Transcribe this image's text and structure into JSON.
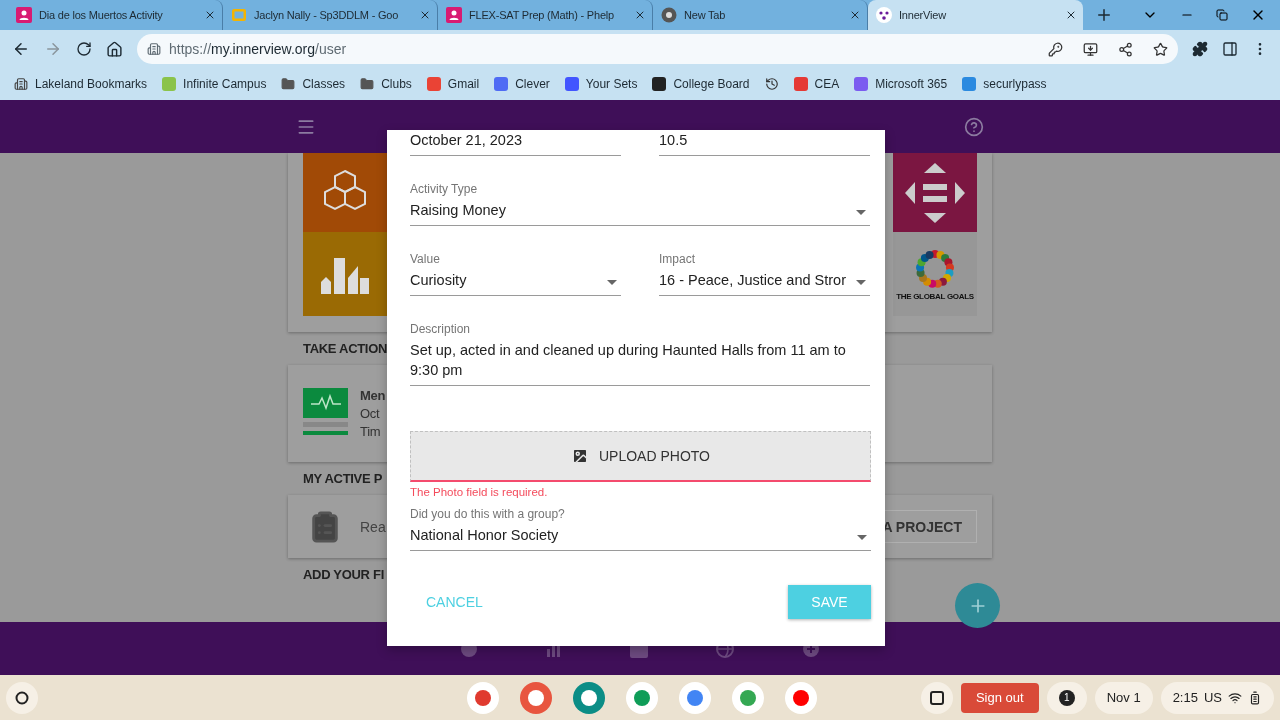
{
  "browser": {
    "tabs": [
      {
        "title": "Dia de los Muertos Activity",
        "selected": false,
        "kind": "classroom"
      },
      {
        "title": "Jaclyn Nally - Sp3DDLM - Goo",
        "selected": false,
        "kind": "slides"
      },
      {
        "title": "FLEX-SAT Prep (Math) - Phelp",
        "selected": false,
        "kind": "classroom"
      },
      {
        "title": "New Tab",
        "selected": false,
        "kind": "chrome"
      },
      {
        "title": "InnerView",
        "selected": true,
        "kind": "innerview"
      }
    ],
    "url": {
      "scheme": "https://",
      "host": "my.innerview.org",
      "path": "/user"
    },
    "bookmarks": [
      {
        "label": "Lakeland Bookmarks",
        "kind": "folder-page"
      },
      {
        "label": "Infinite Campus",
        "kind": "site",
        "color": "#8bc34a"
      },
      {
        "label": "Classes",
        "kind": "folder"
      },
      {
        "label": "Clubs",
        "kind": "folder"
      },
      {
        "label": "Gmail",
        "kind": "site",
        "color": "#ea4335"
      },
      {
        "label": "Clever",
        "kind": "site",
        "color": "#4f6bf4"
      },
      {
        "label": "Your Sets",
        "kind": "site",
        "color": "#4255ff"
      },
      {
        "label": "College Board",
        "kind": "site",
        "color": "#222222"
      },
      {
        "kind": "history"
      },
      {
        "label": "CEA",
        "kind": "site",
        "color": "#e53935"
      },
      {
        "label": "Microsoft 365",
        "kind": "site",
        "color": "#7b5cf0"
      },
      {
        "label": "securlypass",
        "kind": "site",
        "color": "#2b8ae0"
      }
    ]
  },
  "app": {
    "goals_logo": "THE GLOBAL GOALS",
    "take_action": {
      "heading": "TAKE ACTION",
      "title": "Men",
      "date": "Oct",
      "time": "Tim"
    },
    "active_projects": {
      "heading": "MY ACTIVE P",
      "text": "Rea",
      "button": "A PROJECT"
    },
    "add_heading": "ADD YOUR FI"
  },
  "dialog": {
    "rows": [
      {
        "fields": [
          {
            "kind": "text",
            "value": "October 21, 2023"
          },
          {
            "kind": "text",
            "value": "10.5"
          }
        ]
      },
      {
        "fields": [
          {
            "kind": "select",
            "label": "Activity Type",
            "value": "Raising Money"
          }
        ]
      },
      {
        "fields": [
          {
            "kind": "select",
            "label": "Value",
            "value": "Curiosity"
          },
          {
            "kind": "select",
            "label": "Impact",
            "value": "16 - Peace, Justice and Stror"
          }
        ]
      },
      {
        "fields": [
          {
            "kind": "multiline",
            "label": "Description",
            "value": "Set up, acted in and cleaned up during Haunted Halls from 11 am to 9:30 pm"
          }
        ]
      }
    ],
    "upload": {
      "label": "UPLOAD PHOTO",
      "error": "The Photo field is required."
    },
    "group": {
      "label": "Did you do this with a group?",
      "value": "National Honor Society"
    },
    "cancel": "CANCEL",
    "save": "SAVE"
  },
  "shelf": {
    "sign_out": "Sign out",
    "notifications": "1",
    "date": "Nov 1",
    "time": "2:15",
    "locale": "US"
  }
}
